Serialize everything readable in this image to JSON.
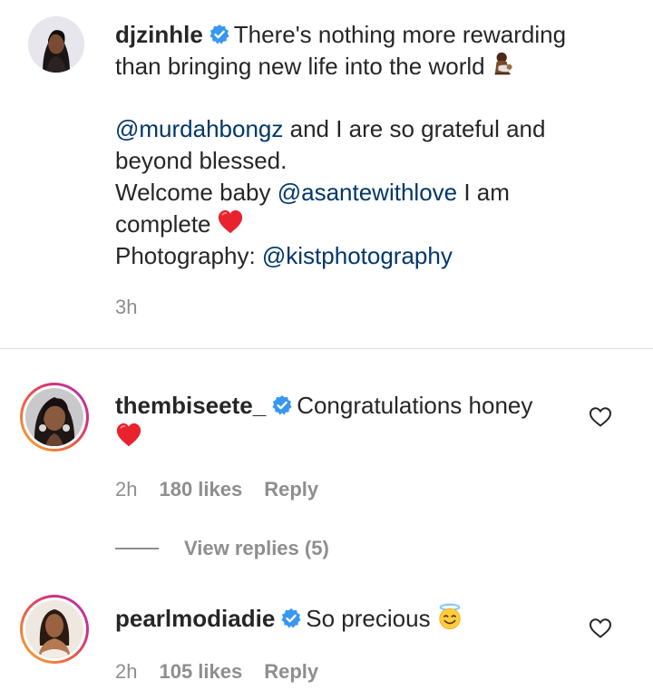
{
  "post": {
    "username": "djzinhle",
    "line1": "There's nothing more rewarding",
    "line2": "than bringing new life into the world",
    "mention1": "@murdahbongz",
    "line3_rest": " and I are so grateful and",
    "line4": "beyond blessed.",
    "line5_pre": "Welcome baby ",
    "mention2": "@asantewithlove",
    "line5_post": " I am",
    "line6": "complete",
    "line7_pre": "Photography: ",
    "mention3": "@kistphotography",
    "time": "3h"
  },
  "comments": [
    {
      "username": "thembiseete_",
      "text": "Congratulations honey",
      "time": "2h",
      "likes": "180 likes",
      "reply": "Reply",
      "view_replies": "View replies (5)"
    },
    {
      "username": "pearlmodiadie",
      "text": "So precious",
      "time": "2h",
      "likes": "105 likes",
      "reply": "Reply"
    }
  ],
  "icons": {
    "verified": "verified-badge-icon",
    "heart": "heart-outline-icon",
    "red_heart": "red-heart-emoji",
    "breastfeeding": "breastfeeding-emoji",
    "halo": "smiling-face-with-halo-emoji"
  },
  "colors": {
    "mention": "#00376b",
    "verified": "#3897f0",
    "meta": "#8e8e8e",
    "text": "#262626",
    "divider": "#dbdbdb"
  }
}
